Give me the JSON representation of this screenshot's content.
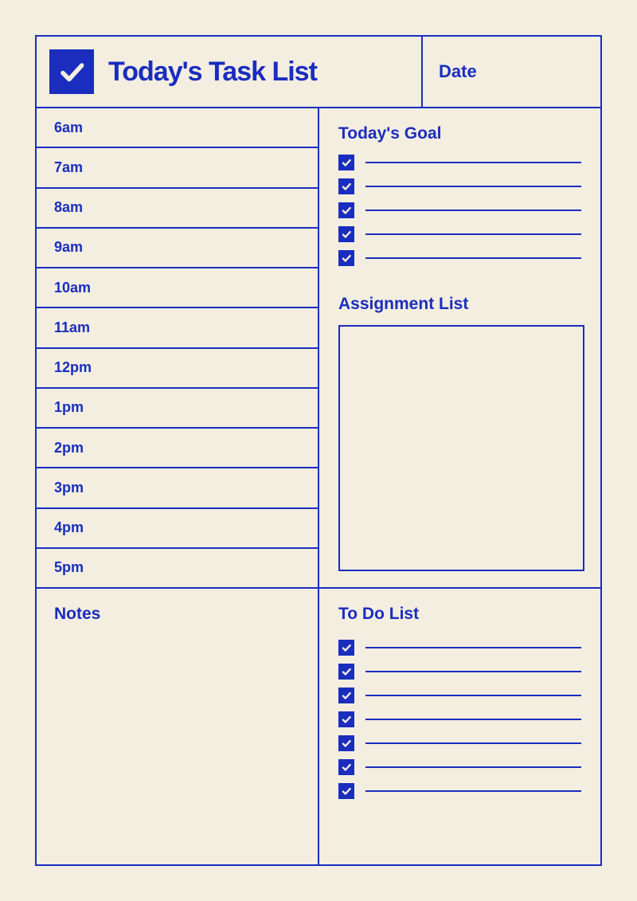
{
  "header": {
    "title": "Today's Task List",
    "date_label": "Date"
  },
  "schedule": {
    "slots": [
      "6am",
      "7am",
      "8am",
      "9am",
      "10am",
      "11am",
      "12pm",
      "1pm",
      "2pm",
      "3pm",
      "4pm",
      "5pm"
    ]
  },
  "goals": {
    "title": "Today's Goal",
    "lines": 5
  },
  "assignment": {
    "title": "Assignment List"
  },
  "notes": {
    "title": "Notes"
  },
  "todo": {
    "title": "To Do List",
    "lines": 7
  },
  "colors": {
    "accent": "#1a2dbf",
    "background": "#f3eee0"
  }
}
